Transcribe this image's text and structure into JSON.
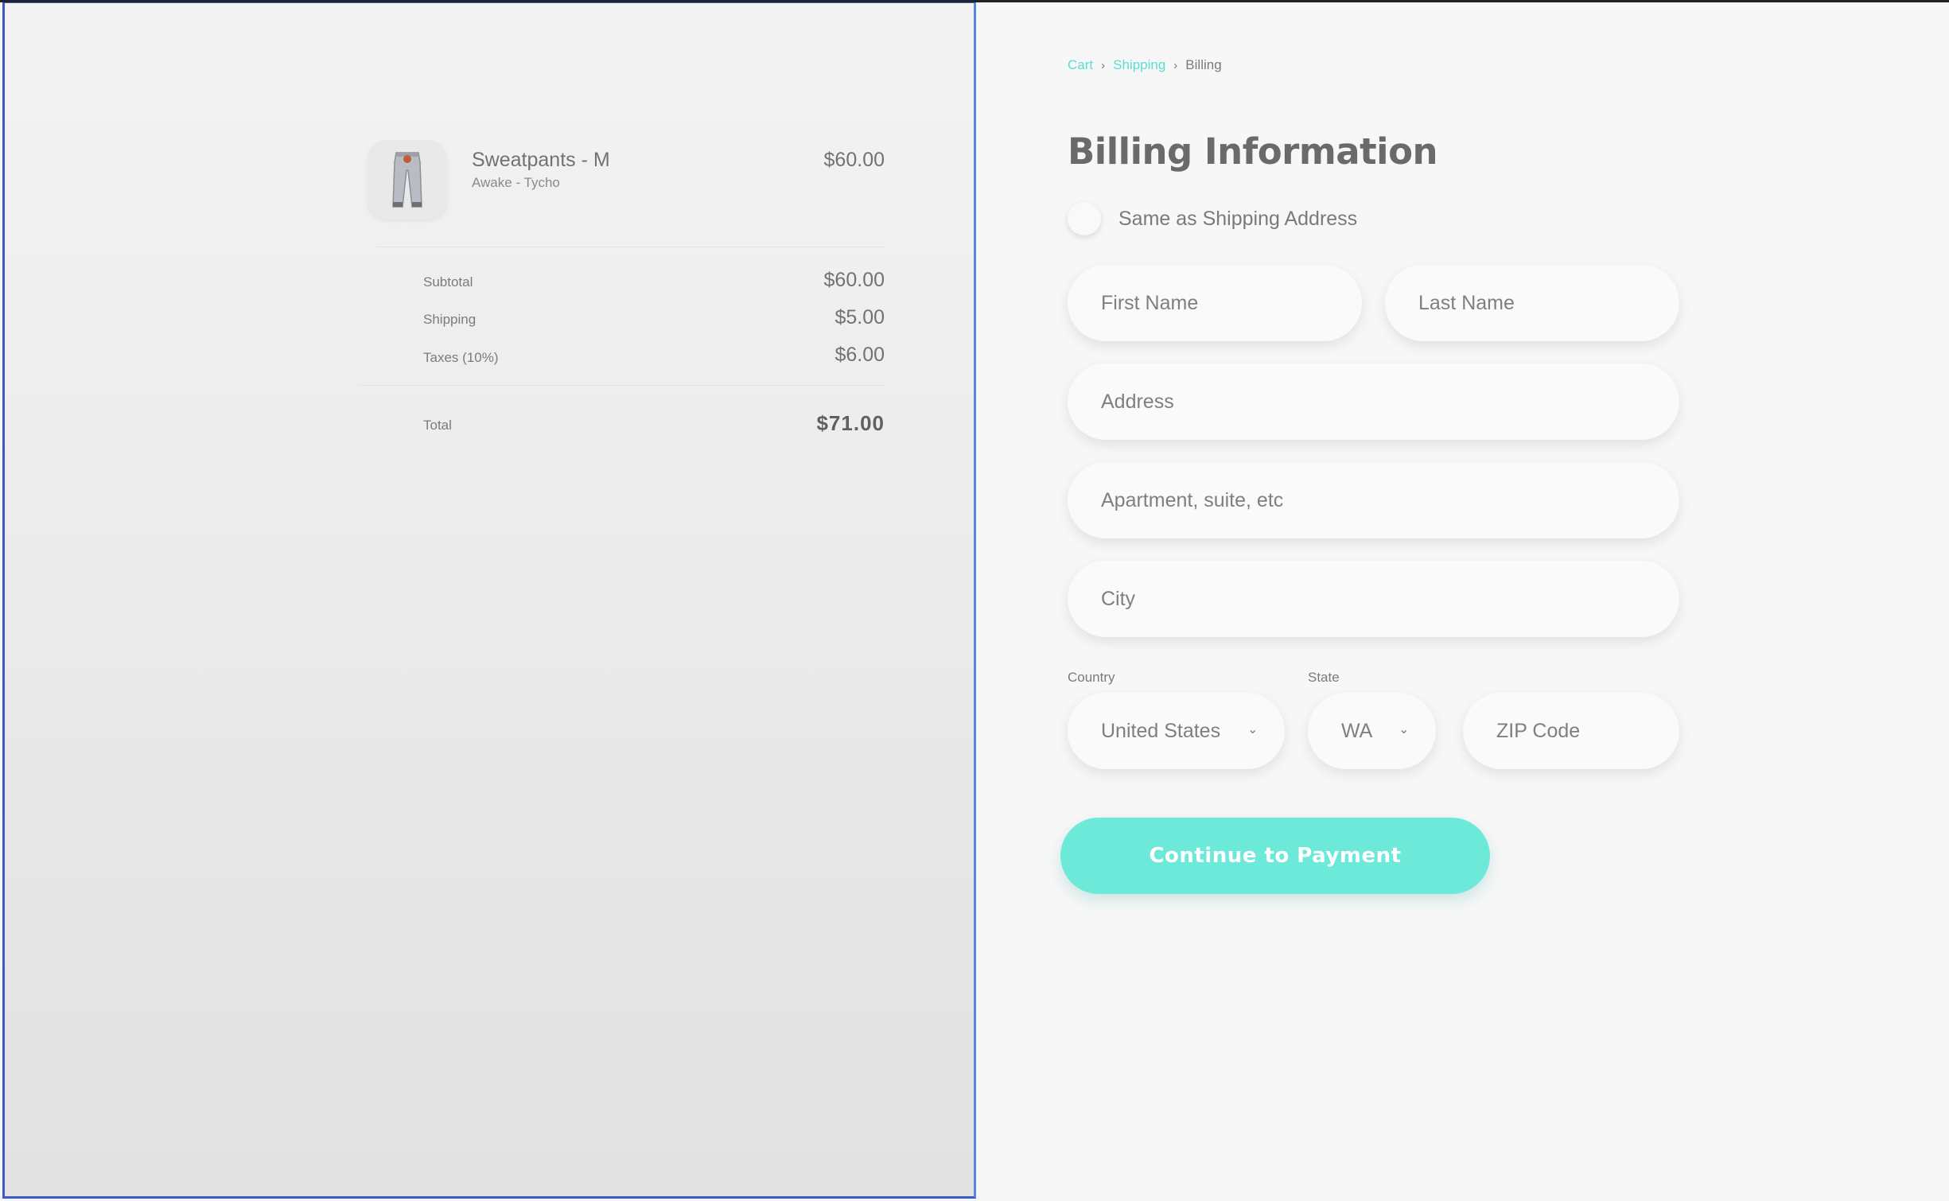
{
  "order_summary": {
    "item": {
      "name": "Sweatpants - M",
      "subtitle": "Awake - Tycho",
      "price": "$60.00",
      "thumbnail_icon": "sweatpants-icon"
    },
    "lines": [
      {
        "label": "Subtotal",
        "value": "$60.00"
      },
      {
        "label": "Shipping",
        "value": "$5.00"
      },
      {
        "label": "Taxes (10%)",
        "value": "$6.00"
      }
    ],
    "total": {
      "label": "Total",
      "value": "$71.00"
    }
  },
  "breadcrumb": {
    "cart": "Cart",
    "shipping": "Shipping",
    "billing": "Billing",
    "separator": "›"
  },
  "billing": {
    "title": "Billing Information",
    "same_as_shipping": "Same as Shipping Address",
    "fields": {
      "first_name": "First Name",
      "last_name": "Last Name",
      "address": "Address",
      "apartment": "Apartment, suite, etc",
      "city": "City",
      "zip": "ZIP Code"
    },
    "country_label": "Country",
    "country_value": "United States",
    "state_label": "State",
    "state_value": "WA",
    "chevron": "⌄",
    "continue_label": "Continue to Payment"
  },
  "colors": {
    "accent": "#6de9da",
    "link": "#5cdcd2",
    "panel_border": "#3b5cc7"
  }
}
